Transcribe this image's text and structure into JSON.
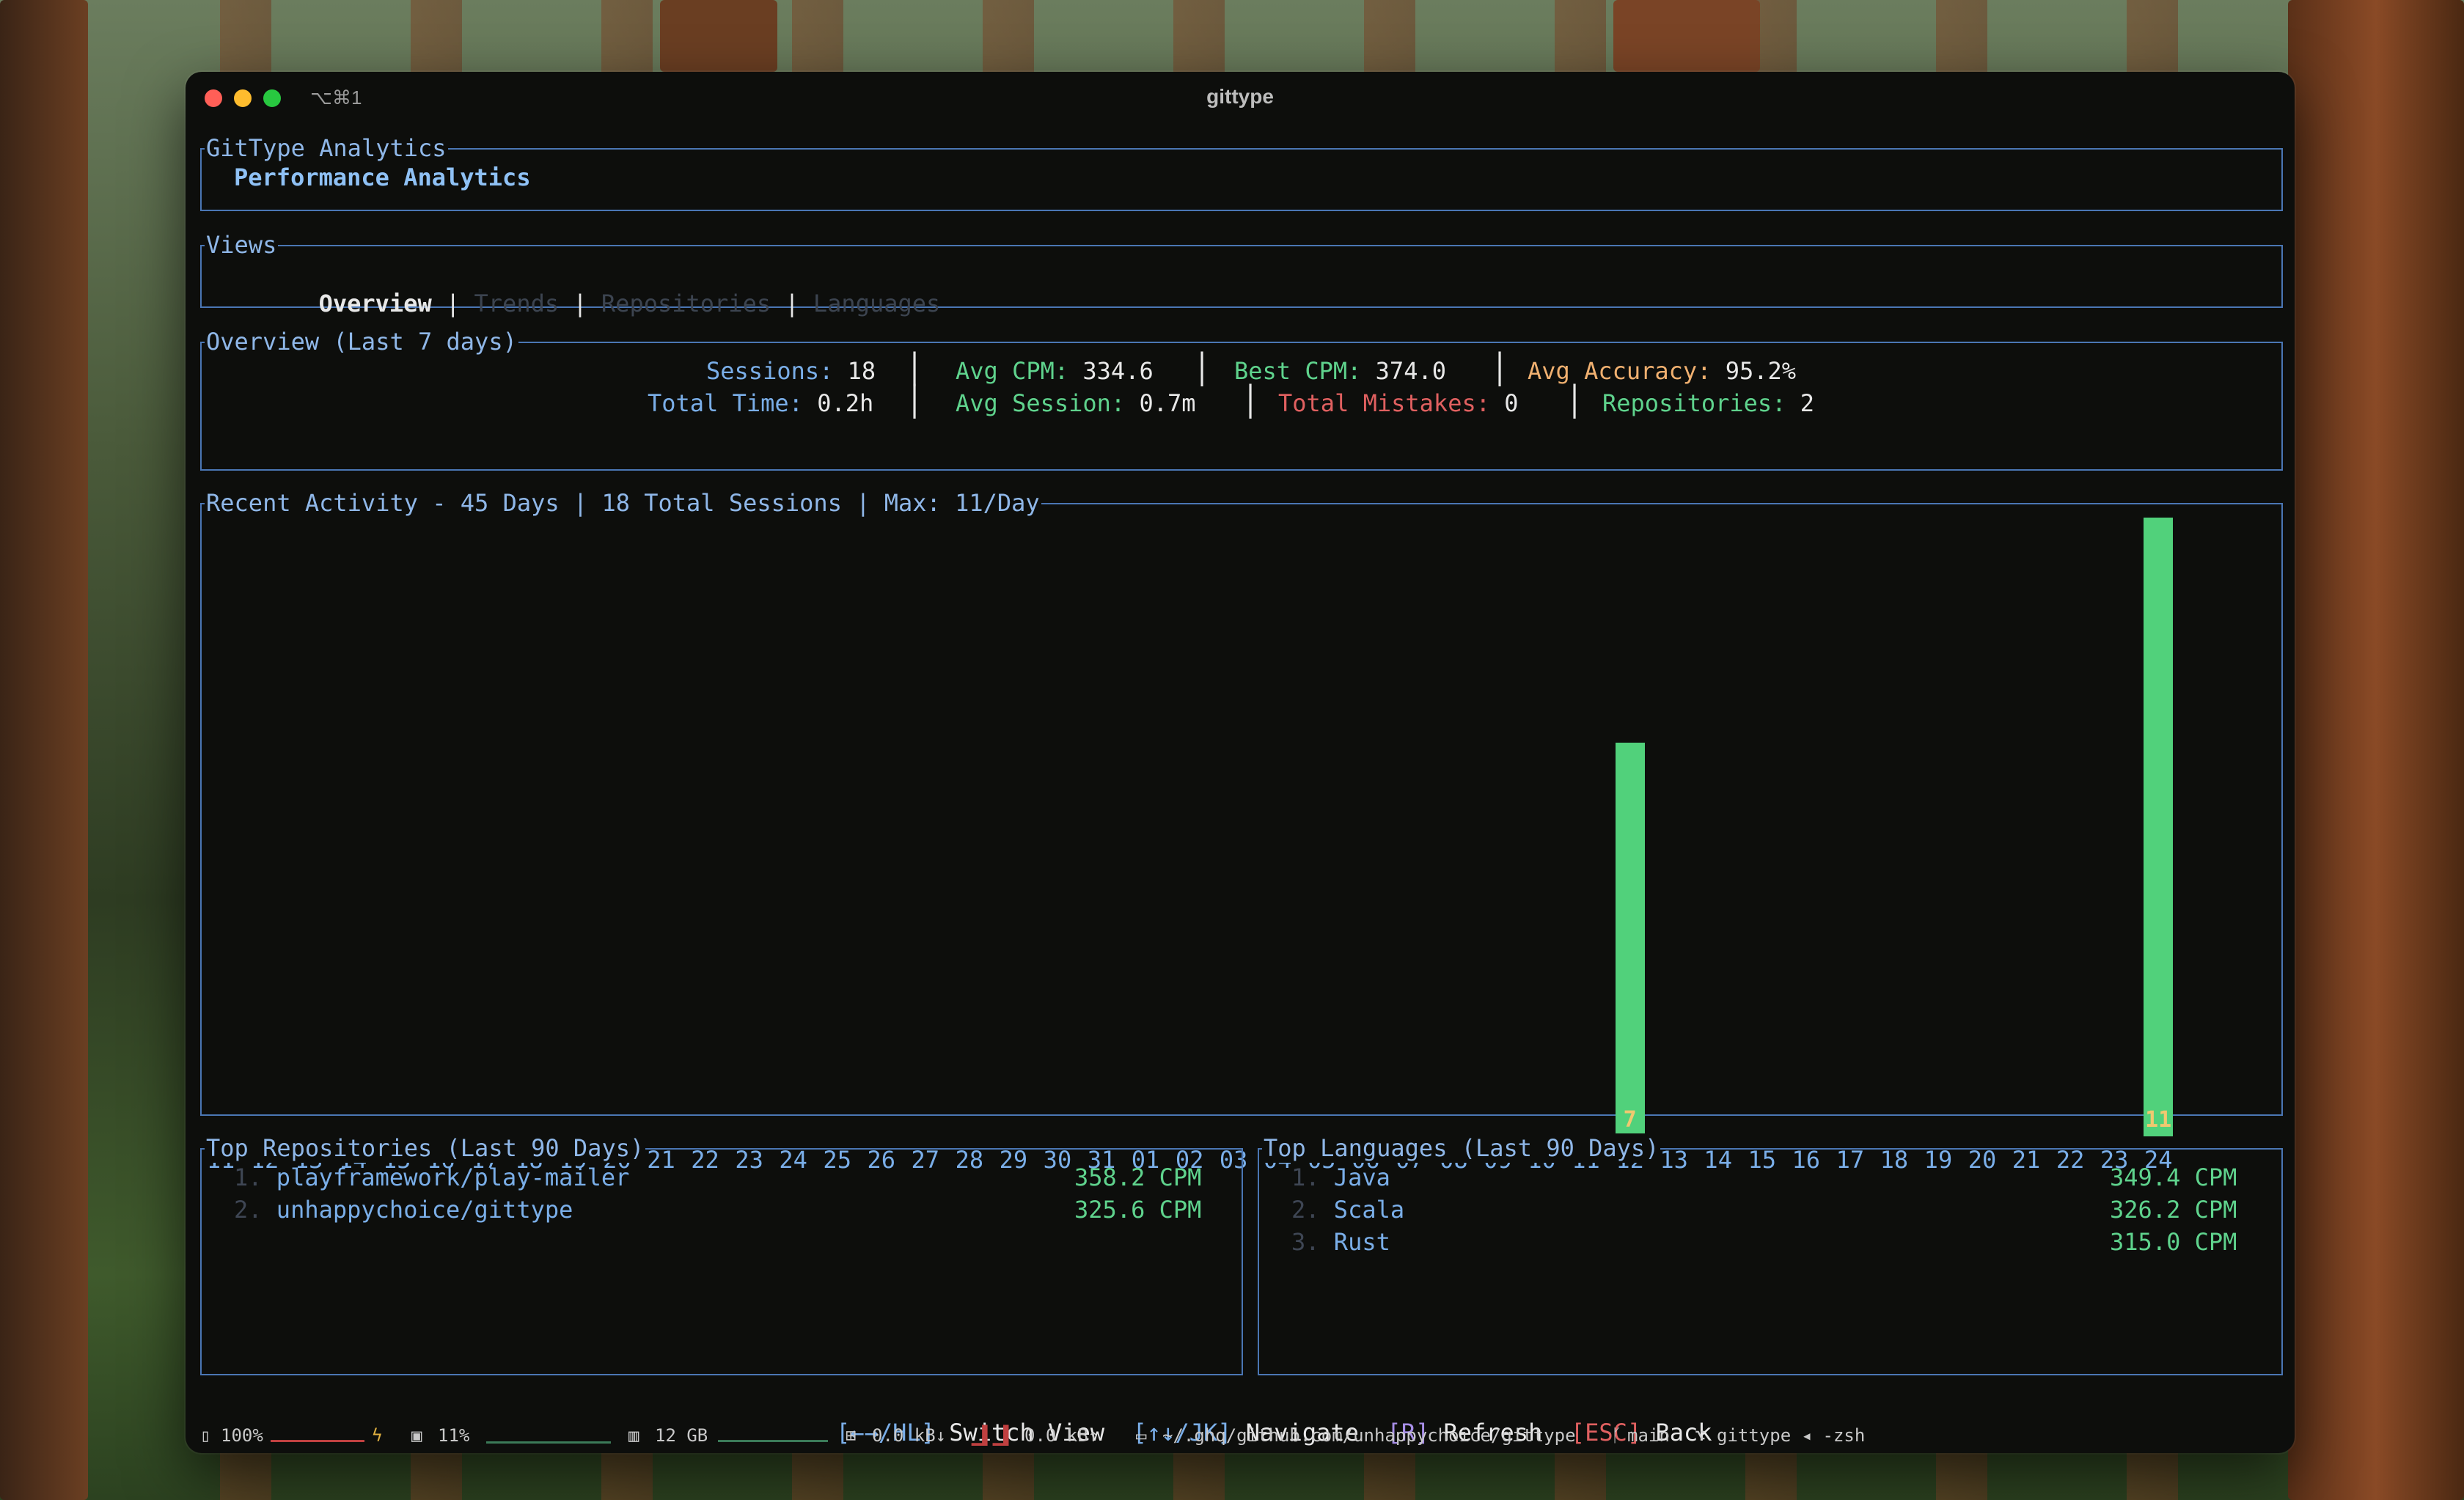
{
  "window": {
    "title": "gittype",
    "shortcut": "⌥⌘1"
  },
  "header": {
    "panel_title": "GitType Analytics",
    "heading": "Performance Analytics"
  },
  "views": {
    "panel_title": "Views",
    "tabs": [
      {
        "label": "Overview",
        "active": true
      },
      {
        "label": "Trends",
        "active": false
      },
      {
        "label": "Repositories",
        "active": false
      },
      {
        "label": "Languages",
        "active": false
      }
    ],
    "separator": "|"
  },
  "overview": {
    "panel_title": "Overview (Last 7 days)",
    "sessions_label": "Sessions:",
    "sessions_value": "18",
    "avg_cpm_label": "Avg CPM:",
    "avg_cpm_value": "334.6",
    "best_cpm_label": "Best CPM:",
    "best_cpm_value": "374.0",
    "avg_accuracy_label": "Avg Accuracy:",
    "avg_accuracy_value": "95.2%",
    "total_time_label": "Total Time:",
    "total_time_value": "0.2h",
    "avg_session_label": "Avg Session:",
    "avg_session_value": "0.7m",
    "total_mistakes_label": "Total Mistakes:",
    "total_mistakes_value": "0",
    "repositories_label": "Repositories:",
    "repositories_value": "2"
  },
  "activity": {
    "panel_title": "Recent Activity - 45 Days | 18 Total Sessions | Max: 11/Day"
  },
  "chart_data": {
    "type": "bar",
    "title": "Recent Activity - 45 Days | 18 Total Sessions | Max: 11/Day",
    "categories": [
      "11",
      "12",
      "13",
      "14",
      "15",
      "16",
      "17",
      "18",
      "19",
      "20",
      "21",
      "22",
      "23",
      "24",
      "25",
      "26",
      "27",
      "28",
      "29",
      "30",
      "31",
      "01",
      "02",
      "03",
      "04",
      "05",
      "06",
      "07",
      "08",
      "09",
      "10",
      "11",
      "12",
      "13",
      "14",
      "15",
      "16",
      "17",
      "18",
      "19",
      "20",
      "21",
      "22",
      "23",
      "24"
    ],
    "values": [
      0,
      0,
      0,
      0,
      0,
      0,
      0,
      0,
      0,
      0,
      0,
      0,
      0,
      0,
      0,
      0,
      0,
      0,
      0,
      0,
      0,
      0,
      0,
      0,
      0,
      0,
      0,
      0,
      0,
      0,
      0,
      0,
      7,
      0,
      0,
      0,
      0,
      0,
      0,
      0,
      0,
      0,
      0,
      0,
      11
    ],
    "ylim": [
      0,
      11
    ],
    "bar_color": "#51d17b",
    "label_color": "#f0c870"
  },
  "top_repositories": {
    "panel_title": "Top Repositories (Last 90 Days)",
    "items": [
      {
        "rank": "1.",
        "name": "playframework/play-mailer",
        "cpm": "358.2 CPM"
      },
      {
        "rank": "2.",
        "name": "unhappychoice/gittype",
        "cpm": "325.6 CPM"
      }
    ]
  },
  "top_languages": {
    "panel_title": "Top Languages (Last 90 Days)",
    "items": [
      {
        "rank": "1.",
        "name": "Java",
        "cpm": "349.4 CPM"
      },
      {
        "rank": "2.",
        "name": "Scala",
        "cpm": "326.2 CPM"
      },
      {
        "rank": "3.",
        "name": "Rust",
        "cpm": "315.0 CPM"
      }
    ]
  },
  "keybinds": [
    {
      "key": "[←→/HL]",
      "action": "Switch View",
      "key_color": "#7aaee8"
    },
    {
      "key": "[↑↓/JK]",
      "action": "Navigate",
      "key_color": "#7aaee8"
    },
    {
      "key": "[R]",
      "action": "Refresh",
      "key_color": "#a78ee8"
    },
    {
      "key": "[ESC]",
      "action": "Back",
      "key_color": "#e06060"
    }
  ],
  "statusbar": {
    "battery": "100%",
    "cpu": "11%",
    "memory": "12 GB",
    "net_down": "0.0 kB↓",
    "net_up": "0.0 kB↑",
    "path": "~/.ghq/github.com/unhappychoice/gittype",
    "branch": "main",
    "session": "gittype ◂ -zsh"
  }
}
